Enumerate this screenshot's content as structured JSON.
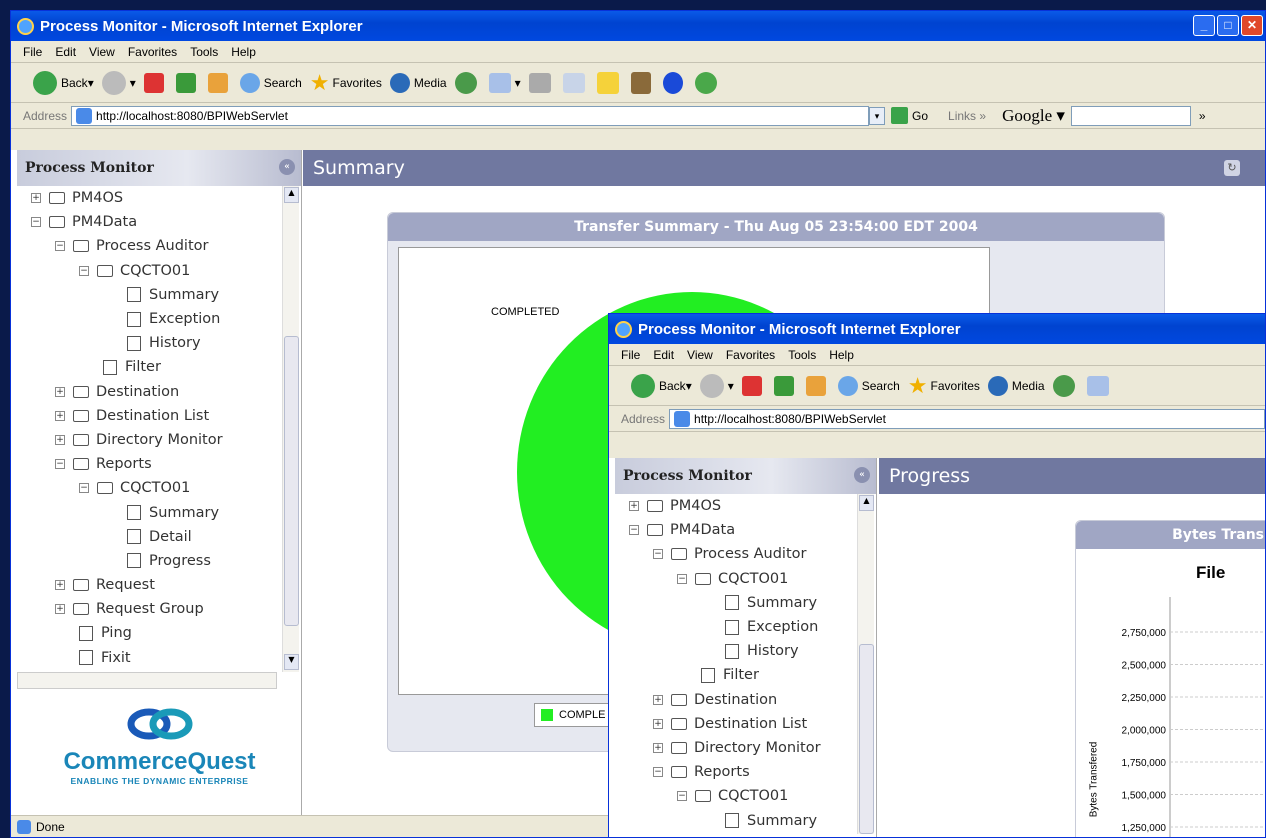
{
  "window1": {
    "title": "Process Monitor - Microsoft Internet Explorer",
    "menu": [
      "File",
      "Edit",
      "View",
      "Favorites",
      "Tools",
      "Help"
    ],
    "toolbar": {
      "back": "Back",
      "search": "Search",
      "favorites": "Favorites",
      "media": "Media"
    },
    "address": {
      "label": "Address",
      "url": "http://localhost:8080/BPIWebServlet",
      "go": "Go",
      "links": "Links",
      "google": "Google"
    },
    "sidebar": {
      "title": "Process Monitor",
      "tree": [
        {
          "label": "PM4OS",
          "type": "folder",
          "toggle": "+",
          "indent": 0
        },
        {
          "label": "PM4Data",
          "type": "folder",
          "toggle": "−",
          "indent": 0
        },
        {
          "label": "Process Auditor",
          "type": "folder",
          "toggle": "−",
          "indent": 1
        },
        {
          "label": "CQCTO01",
          "type": "folder",
          "toggle": "−",
          "indent": 2
        },
        {
          "label": "Summary",
          "type": "page",
          "indent": 4
        },
        {
          "label": "Exception",
          "type": "page",
          "indent": 4
        },
        {
          "label": "History",
          "type": "page",
          "indent": 4
        },
        {
          "label": "Filter",
          "type": "page",
          "indent": 3
        },
        {
          "label": "Destination",
          "type": "folder",
          "toggle": "+",
          "indent": 1
        },
        {
          "label": "Destination List",
          "type": "folder",
          "toggle": "+",
          "indent": 1
        },
        {
          "label": "Directory Monitor",
          "type": "folder",
          "toggle": "+",
          "indent": 1
        },
        {
          "label": "Reports",
          "type": "folder",
          "toggle": "−",
          "indent": 1
        },
        {
          "label": "CQCTO01",
          "type": "folder",
          "toggle": "−",
          "indent": 2
        },
        {
          "label": "Summary",
          "type": "page",
          "indent": 4
        },
        {
          "label": "Detail",
          "type": "page",
          "indent": 4
        },
        {
          "label": "Progress",
          "type": "page",
          "indent": 4
        },
        {
          "label": "Request",
          "type": "folder",
          "toggle": "+",
          "indent": 1
        },
        {
          "label": "Request Group",
          "type": "folder",
          "toggle": "+",
          "indent": 1
        },
        {
          "label": "Ping",
          "type": "page",
          "indent": 2
        },
        {
          "label": "Fixit",
          "type": "page",
          "indent": 2
        }
      ]
    },
    "logo": {
      "name": "CommerceQuest",
      "tagline": "ENABLING THE DYNAMIC ENTERPRISE"
    },
    "main": {
      "title": "Summary"
    },
    "panel": {
      "title": "Transfer Summary - Thu Aug 05 23:54:00 EDT 2004",
      "pie_label": "COMPLETED",
      "legend": "COMPLE"
    },
    "status": "Done"
  },
  "window2": {
    "title": "Process Monitor - Microsoft Internet Explorer",
    "menu": [
      "File",
      "Edit",
      "View",
      "Favorites",
      "Tools",
      "Help"
    ],
    "toolbar": {
      "back": "Back",
      "search": "Search",
      "favorites": "Favorites",
      "media": "Media"
    },
    "address": {
      "label": "Address",
      "url": "http://localhost:8080/BPIWebServlet"
    },
    "sidebar": {
      "title": "Process Monitor",
      "tree": [
        {
          "label": "PM4OS",
          "type": "folder",
          "toggle": "+",
          "indent": 0
        },
        {
          "label": "PM4Data",
          "type": "folder",
          "toggle": "−",
          "indent": 0
        },
        {
          "label": "Process Auditor",
          "type": "folder",
          "toggle": "−",
          "indent": 1
        },
        {
          "label": "CQCTO01",
          "type": "folder",
          "toggle": "−",
          "indent": 2
        },
        {
          "label": "Summary",
          "type": "page",
          "indent": 4
        },
        {
          "label": "Exception",
          "type": "page",
          "indent": 4
        },
        {
          "label": "History",
          "type": "page",
          "indent": 4
        },
        {
          "label": "Filter",
          "type": "page",
          "indent": 3
        },
        {
          "label": "Destination",
          "type": "folder",
          "toggle": "+",
          "indent": 1
        },
        {
          "label": "Destination List",
          "type": "folder",
          "toggle": "+",
          "indent": 1
        },
        {
          "label": "Directory Monitor",
          "type": "folder",
          "toggle": "+",
          "indent": 1
        },
        {
          "label": "Reports",
          "type": "folder",
          "toggle": "−",
          "indent": 1
        },
        {
          "label": "CQCTO01",
          "type": "folder",
          "toggle": "−",
          "indent": 2
        },
        {
          "label": "Summary",
          "type": "page",
          "indent": 4
        }
      ]
    },
    "main": {
      "title": "Progress"
    },
    "panel": {
      "title": "Bytes Trans",
      "chart_title": "File"
    },
    "chart_data": {
      "type": "line",
      "ylabel": "Bytes Transfered",
      "yticks": [
        "2,750,000",
        "2,500,000",
        "2,250,000",
        "2,000,000",
        "1,750,000",
        "1,500,000",
        "1,250,000"
      ]
    }
  },
  "colors": {
    "pie": "#22ee22",
    "sidehead": "#7078a0",
    "title": "#0048e0"
  }
}
